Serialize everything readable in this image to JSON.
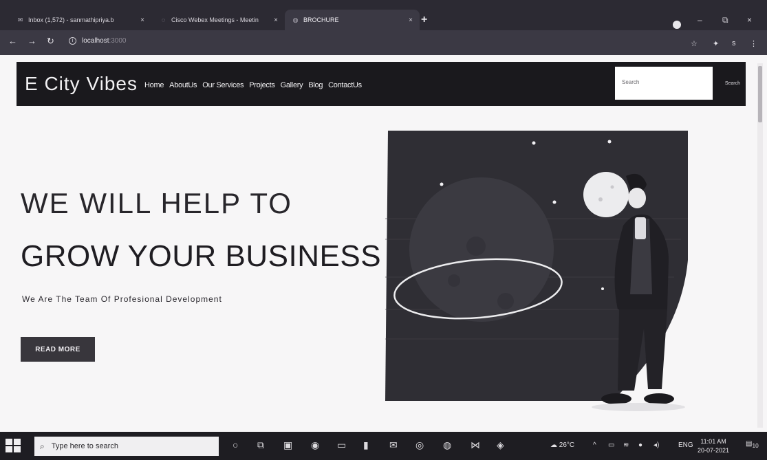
{
  "browser": {
    "tabs": [
      {
        "title": "Inbox (1,572) - sanmathipriya.b",
        "icon": "mail-icon"
      },
      {
        "title": "Cisco Webex Meetings - Meetin",
        "icon": "webex-icon"
      },
      {
        "title": "BROCHURE",
        "icon": "globe-icon"
      }
    ],
    "new_tab": "+",
    "address": "localhost",
    "address_port": ":3000",
    "window_controls": {
      "minimize": "–",
      "restore": "⧉",
      "close": "×"
    }
  },
  "site": {
    "brand": "E City Vibes",
    "menu": [
      "Home",
      "AboutUs",
      "Our Services",
      "Projects",
      "Gallery",
      "Blog",
      "ContactUs"
    ],
    "search_placeholder": "Search",
    "search_button": "Search"
  },
  "hero": {
    "line1": "WE WILL HELP TO",
    "line2": "GROW YOUR BUSINESS",
    "tagline": "We Are The Team Of Profesional Development",
    "cta": "READ MORE"
  },
  "taskbar": {
    "search_placeholder": "Type here to search",
    "weather": "26°C",
    "language": "ENG",
    "time": "11:01 AM",
    "date": "20-07-2021",
    "notifications": "10"
  },
  "colors": {
    "nav_bg": "#1a191d",
    "hero_text": "#1f1d22",
    "button_bg": "#38363c",
    "taskbar_bg": "#1e1d22"
  }
}
